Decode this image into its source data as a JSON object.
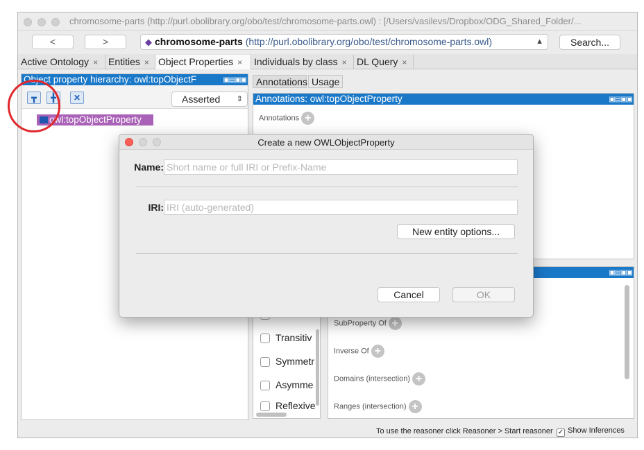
{
  "window": {
    "title": "chromosome-parts (http://purl.obolibrary.org/obo/test/chromosome-parts.owl)  : [/Users/vasilevs/Dropbox/ODG_Shared_Folder/..."
  },
  "toolbar": {
    "back": "<",
    "forward": ">",
    "ontology_name": "chromosome-parts",
    "ontology_iri": "(http://purl.obolibrary.org/obo/test/chromosome-parts.owl)",
    "search_label": "Search..."
  },
  "tabs": [
    {
      "label": "Active Ontology"
    },
    {
      "label": "Entities"
    },
    {
      "label": "Object Properties"
    },
    {
      "label": "Individuals by class"
    },
    {
      "label": "DL Query"
    }
  ],
  "left_panel": {
    "header": "Object property hierarchy: owl:topObjectF",
    "view_mode": "Asserted",
    "tree_item": "owl:topObjectProperty"
  },
  "right_tabs": [
    {
      "label": "Annotations"
    },
    {
      "label": "Usage"
    }
  ],
  "annotations_panel": {
    "header": "Annotations: owl:topObjectProperty",
    "annotations_label": "Annotations"
  },
  "characteristics": [
    {
      "label": "Inverse f"
    },
    {
      "label": "Transitiv"
    },
    {
      "label": "Symmetr"
    },
    {
      "label": "Asymme"
    },
    {
      "label": "Reflexive"
    }
  ],
  "description": {
    "sections": [
      {
        "label": "SubProperty Of"
      },
      {
        "label": "Inverse Of"
      },
      {
        "label": "Domains (intersection)"
      },
      {
        "label": "Ranges (intersection)"
      }
    ]
  },
  "status": {
    "reasoner_text": "To use the reasoner click Reasoner > Start reasoner",
    "show_inferences": "Show Inferences"
  },
  "dialog": {
    "title": "Create a new OWLObjectProperty",
    "name_label": "Name:",
    "name_placeholder": "Short name or full IRI or Prefix-Name",
    "iri_label": "IRI:",
    "iri_placeholder": "IRI (auto-generated)",
    "options_button": "New entity options...",
    "cancel_button": "Cancel",
    "ok_button": "OK"
  },
  "colors": {
    "panel_header": "#1a78c8",
    "selected_item": "#a962b7",
    "annotation_red": "#e0282c"
  }
}
